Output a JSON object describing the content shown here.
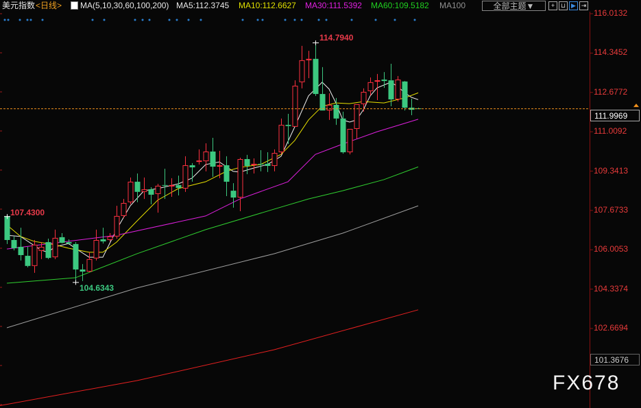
{
  "header": {
    "symbol": "美元指数",
    "period": "<日线>",
    "ma_params": "MA(5,10,30,60,100,200)",
    "ma5": "MA5:112.3745",
    "ma10": "MA10:112.6627",
    "ma30": "MA30:111.5392",
    "ma60": "MA60:109.5182",
    "ma100": "MA100",
    "theme_button": "全部主题▼"
  },
  "watermark": "FX678",
  "colors": {
    "up": "#ff3040",
    "down": "#3cc880",
    "ma5": "#f0f0f0",
    "ma10": "#e8e000",
    "ma30": "#e020e0",
    "ma60": "#30d030",
    "ma100": "#a0a0a0",
    "ma200": "#e82020",
    "current": "#f0901c"
  },
  "chart_data": {
    "type": "candlestick",
    "title": "美元指数 日线",
    "ylim": [
      99.2,
      116.2
    ],
    "y_ticks": [
      "116.0132",
      "114.3452",
      "112.6772",
      "111.0092",
      "109.3413",
      "107.6733",
      "106.0053",
      "104.3374",
      "102.6694"
    ],
    "current_price": "111.9969",
    "range_min_label": "101.3676",
    "annotations": {
      "high": "114.7940",
      "low": "104.6343",
      "left_high": "107.4300"
    },
    "ohlc": [
      [
        107.43,
        107.43,
        106.25,
        106.42
      ],
      [
        106.42,
        106.57,
        105.98,
        106.07
      ],
      [
        106.13,
        106.94,
        105.55,
        105.78
      ],
      [
        105.75,
        106.13,
        105.26,
        105.32
      ],
      [
        105.32,
        106.42,
        105.03,
        106.22
      ],
      [
        105.96,
        106.33,
        105.61,
        106.13
      ],
      [
        106.33,
        106.48,
        105.61,
        105.66
      ],
      [
        105.69,
        106.86,
        105.61,
        106.51
      ],
      [
        106.54,
        106.71,
        106.27,
        106.3
      ],
      [
        106.33,
        106.45,
        106.22,
        106.27
      ],
      [
        106.25,
        106.33,
        104.63,
        105.17
      ],
      [
        105.17,
        105.4,
        104.68,
        105.08
      ],
      [
        105.08,
        105.9,
        105.05,
        105.61
      ],
      [
        105.64,
        106.86,
        105.55,
        106.42
      ],
      [
        106.45,
        106.94,
        106.27,
        106.36
      ],
      [
        106.42,
        106.71,
        106.36,
        106.57
      ],
      [
        106.57,
        107.87,
        106.48,
        107.44
      ],
      [
        107.44,
        108.16,
        107.35,
        107.99
      ],
      [
        108.02,
        109.07,
        107.93,
        108.89
      ],
      [
        108.89,
        109.24,
        108.02,
        108.46
      ],
      [
        108.46,
        109.07,
        108.16,
        108.57
      ],
      [
        108.57,
        108.66,
        107.93,
        108.34
      ],
      [
        108.37,
        108.8,
        107.58,
        108.72
      ],
      [
        108.75,
        109.44,
        108.16,
        108.72
      ],
      [
        108.72,
        109.04,
        108.25,
        108.75
      ],
      [
        108.75,
        109.15,
        108.31,
        108.63
      ],
      [
        108.6,
        109.97,
        108.46,
        109.59
      ],
      [
        109.59,
        109.68,
        108.89,
        109.5
      ],
      [
        109.73,
        110.26,
        109.62,
        109.79
      ],
      [
        109.76,
        110.52,
        109.33,
        110.17
      ],
      [
        110.17,
        110.75,
        109.1,
        109.53
      ],
      [
        109.53,
        110.2,
        109.04,
        109.59
      ],
      [
        109.59,
        109.97,
        108.28,
        108.89
      ],
      [
        108.51,
        108.83,
        107.79,
        108.22
      ],
      [
        108.22,
        109.91,
        107.64,
        109.85
      ],
      [
        109.85,
        110.03,
        109.21,
        109.56
      ],
      [
        109.59,
        109.88,
        109.24,
        109.65
      ],
      [
        109.65,
        110.23,
        109.33,
        109.62
      ],
      [
        109.65,
        110.14,
        109.3,
        109.56
      ],
      [
        109.56,
        110.26,
        109.33,
        110.11
      ],
      [
        110.14,
        111.57,
        110.05,
        111.3
      ],
      [
        111.3,
        111.77,
        110.49,
        111.25
      ],
      [
        111.22,
        113.19,
        111.22,
        112.96
      ],
      [
        113.11,
        114.65,
        112.85,
        114.04
      ],
      [
        114.04,
        114.44,
        113.28,
        114.1
      ],
      [
        114.1,
        114.794,
        112.53,
        112.61
      ],
      [
        112.61,
        113.75,
        111.91,
        111.91
      ],
      [
        111.91,
        112.64,
        111.51,
        112.15
      ],
      [
        112.15,
        112.44,
        111.3,
        111.57
      ],
      [
        111.57,
        111.86,
        110.08,
        110.14
      ],
      [
        110.14,
        111.13,
        110.05,
        111.13
      ],
      [
        111.13,
        112.18,
        110.72,
        112.18
      ],
      [
        112.18,
        112.85,
        111.86,
        112.7
      ],
      [
        112.73,
        113.31,
        112.55,
        113.11
      ],
      [
        113.14,
        113.46,
        112.35,
        113.19
      ],
      [
        113.22,
        113.54,
        112.87,
        113.16
      ],
      [
        113.19,
        113.89,
        112.09,
        112.38
      ],
      [
        112.38,
        113.37,
        112.29,
        113.22
      ],
      [
        113.14,
        113.16,
        111.91,
        112.03
      ],
      [
        112.03,
        112.41,
        111.71,
        111.94
      ],
      [
        112.0,
        112.03,
        111.97,
        111.9969
      ]
    ],
    "series": [
      {
        "name": "MA5",
        "points": [
          [
            0,
            106.62
          ],
          [
            2,
            106.57
          ],
          [
            5,
            105.99
          ],
          [
            6,
            105.9
          ],
          [
            7,
            106.13
          ],
          [
            9,
            106.27
          ],
          [
            10,
            106.07
          ],
          [
            12,
            105.69
          ],
          [
            14,
            105.69
          ],
          [
            16,
            106.86
          ],
          [
            18,
            107.87
          ],
          [
            20,
            108.51
          ],
          [
            22,
            108.6
          ],
          [
            25,
            108.8
          ],
          [
            27,
            109.04
          ],
          [
            29,
            109.62
          ],
          [
            31,
            109.73
          ],
          [
            33,
            109.33
          ],
          [
            34,
            109.3
          ],
          [
            36,
            109.47
          ],
          [
            38,
            109.62
          ],
          [
            40,
            109.97
          ],
          [
            42,
            111.22
          ],
          [
            44,
            112.53
          ],
          [
            46,
            113.11
          ],
          [
            47,
            112.82
          ],
          [
            48,
            112.23
          ],
          [
            49,
            111.51
          ],
          [
            50,
            111.42
          ],
          [
            51,
            111.51
          ],
          [
            52,
            111.94
          ],
          [
            53,
            112.53
          ],
          [
            54,
            112.87
          ],
          [
            55,
            112.99
          ],
          [
            56,
            113.11
          ],
          [
            57,
            112.93
          ],
          [
            58,
            112.67
          ],
          [
            59,
            112.47
          ],
          [
            60,
            112.37
          ]
        ]
      },
      {
        "name": "MA10",
        "points": [
          [
            0,
            107.06
          ],
          [
            2,
            106.57
          ],
          [
            4,
            106.36
          ],
          [
            7,
            106.22
          ],
          [
            9,
            106.07
          ],
          [
            12,
            105.9
          ],
          [
            14,
            105.9
          ],
          [
            16,
            106.33
          ],
          [
            19,
            107.23
          ],
          [
            22,
            108.11
          ],
          [
            25,
            108.6
          ],
          [
            29,
            108.89
          ],
          [
            32,
            109.33
          ],
          [
            34,
            109.5
          ],
          [
            37,
            109.62
          ],
          [
            40,
            110.05
          ],
          [
            42,
            110.64
          ],
          [
            44,
            111.51
          ],
          [
            46,
            112.09
          ],
          [
            48,
            112.23
          ],
          [
            50,
            112.2
          ],
          [
            52,
            112.29
          ],
          [
            55,
            112.23
          ],
          [
            58,
            112.44
          ],
          [
            60,
            112.66
          ]
        ]
      },
      {
        "name": "MA30",
        "points": [
          [
            0,
            106.04
          ],
          [
            16,
            106.62
          ],
          [
            29,
            107.44
          ],
          [
            34,
            108.16
          ],
          [
            41,
            108.89
          ],
          [
            45,
            110.05
          ],
          [
            49,
            110.49
          ],
          [
            54,
            111.01
          ],
          [
            60,
            111.54
          ]
        ]
      },
      {
        "name": "MA60",
        "points": [
          [
            0,
            104.59
          ],
          [
            10,
            104.82
          ],
          [
            19,
            105.84
          ],
          [
            29,
            106.86
          ],
          [
            39,
            107.73
          ],
          [
            44,
            108.16
          ],
          [
            49,
            108.51
          ],
          [
            55,
            108.98
          ],
          [
            60,
            109.52
          ]
        ]
      },
      {
        "name": "MA100",
        "points": [
          [
            0,
            102.7
          ],
          [
            19,
            104.39
          ],
          [
            39,
            105.84
          ],
          [
            49,
            106.71
          ],
          [
            60,
            107.87
          ]
        ]
      },
      {
        "name": "MA200",
        "points": [
          [
            -1,
            99.4
          ],
          [
            19,
            100.46
          ],
          [
            39,
            101.77
          ],
          [
            60,
            103.46
          ]
        ]
      }
    ]
  }
}
